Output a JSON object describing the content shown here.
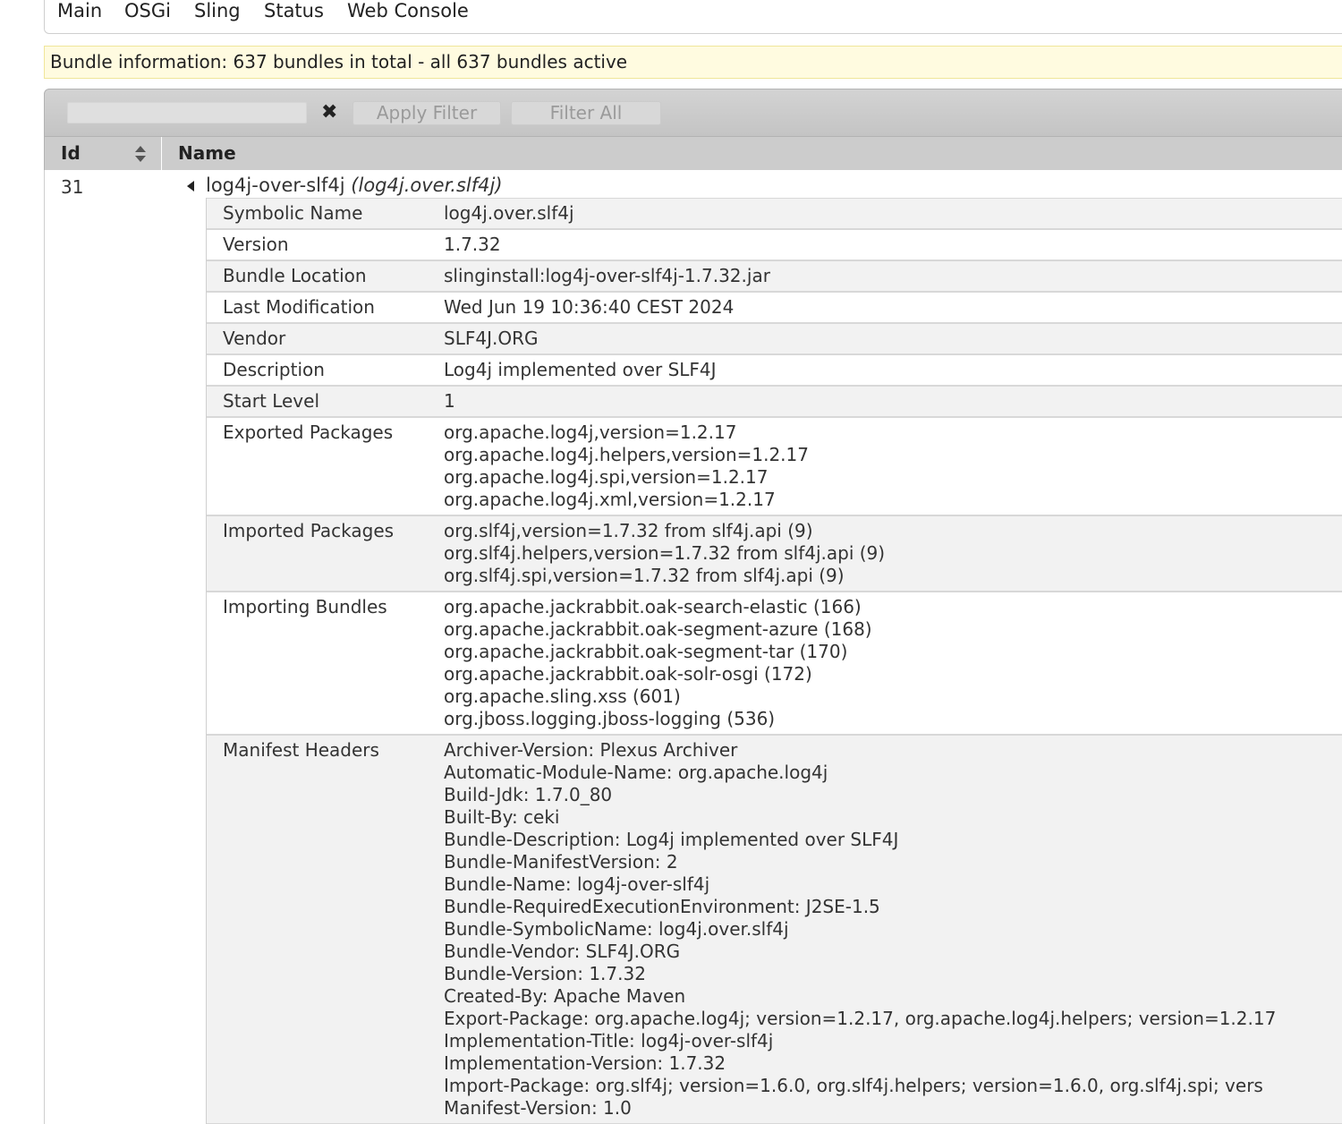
{
  "nav": {
    "items": [
      "Main",
      "OSGi",
      "Sling",
      "Status",
      "Web Console"
    ]
  },
  "status_line": "Bundle information: 637 bundles in total - all 637 bundles active",
  "filter": {
    "input_value": "",
    "clear_icon": "close-icon",
    "apply_label": "Apply Filter",
    "filter_all_label": "Filter All"
  },
  "table": {
    "col_id": "Id",
    "col_name": "Name",
    "sort_icon": "sort-icon"
  },
  "bundle": {
    "id": "31",
    "name": "log4j-over-slf4j",
    "symbolic_paren": "(log4j.over.slf4j)",
    "expand_icon": "collapse-triangle-icon",
    "details": [
      {
        "label": "Symbolic Name",
        "values": [
          "log4j.over.slf4j"
        ]
      },
      {
        "label": "Version",
        "values": [
          "1.7.32"
        ]
      },
      {
        "label": "Bundle Location",
        "values": [
          "slinginstall:log4j-over-slf4j-1.7.32.jar"
        ]
      },
      {
        "label": "Last Modification",
        "values": [
          "Wed Jun 19 10:36:40 CEST 2024"
        ]
      },
      {
        "label": "Vendor",
        "values": [
          "SLF4J.ORG"
        ]
      },
      {
        "label": "Description",
        "values": [
          "Log4j implemented over SLF4J"
        ]
      },
      {
        "label": "Start Level",
        "values": [
          "1"
        ]
      },
      {
        "label": "Exported Packages",
        "values": [
          "org.apache.log4j,version=1.2.17",
          "org.apache.log4j.helpers,version=1.2.17",
          "org.apache.log4j.spi,version=1.2.17",
          "org.apache.log4j.xml,version=1.2.17"
        ]
      },
      {
        "label": "Imported Packages",
        "values": [
          "org.slf4j,version=1.7.32 from slf4j.api (9)",
          "org.slf4j.helpers,version=1.7.32 from slf4j.api (9)",
          "org.slf4j.spi,version=1.7.32 from slf4j.api (9)"
        ]
      },
      {
        "label": "Importing Bundles",
        "values": [
          "org.apache.jackrabbit.oak-search-elastic (166)",
          "org.apache.jackrabbit.oak-segment-azure (168)",
          "org.apache.jackrabbit.oak-segment-tar (170)",
          "org.apache.jackrabbit.oak-solr-osgi (172)",
          "org.apache.sling.xss (601)",
          "org.jboss.logging.jboss-logging (536)"
        ]
      },
      {
        "label": "Manifest Headers",
        "values": [
          "Archiver-Version: Plexus Archiver",
          "Automatic-Module-Name: org.apache.log4j",
          "Build-Jdk: 1.7.0_80",
          "Built-By: ceki",
          "Bundle-Description: Log4j implemented over SLF4J",
          "Bundle-ManifestVersion: 2",
          "Bundle-Name: log4j-over-slf4j",
          "Bundle-RequiredExecutionEnvironment: J2SE-1.5",
          "Bundle-SymbolicName: log4j.over.slf4j",
          "Bundle-Vendor: SLF4J.ORG",
          "Bundle-Version: 1.7.32",
          "Created-By: Apache Maven",
          "Export-Package: org.apache.log4j; version=1.2.17, org.apache.log4j.helpers; version=1.2.17",
          "Implementation-Title: log4j-over-slf4j",
          "Implementation-Version: 1.7.32",
          "Import-Package: org.slf4j; version=1.6.0, org.slf4j.helpers; version=1.6.0, org.slf4j.spi; vers",
          "Manifest-Version: 1.0"
        ]
      }
    ]
  },
  "colors": {
    "status_bg": "#fffbe0",
    "header_bg": "#cccccc",
    "row_alt_bg": "#f2f2f2"
  }
}
